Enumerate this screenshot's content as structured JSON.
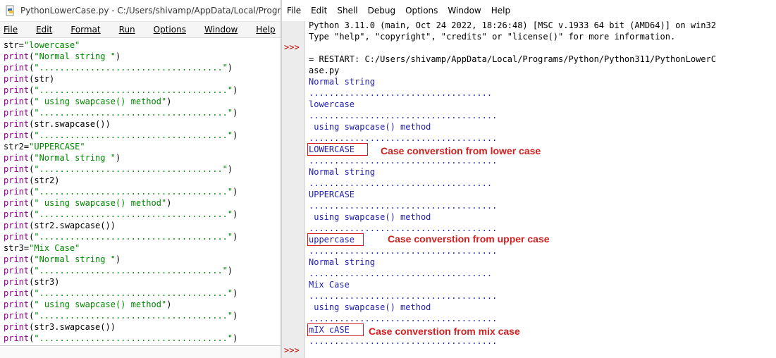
{
  "editor": {
    "title": "PythonLowerCase.py - C:/Users/shivamp/AppData/Local/Programs/Py",
    "menu": [
      "File",
      "Edit",
      "Format",
      "Run",
      "Options",
      "Window",
      "Help"
    ],
    "code": [
      {
        "a": "str=",
        "s": "\"lowercase\"",
        "b": ""
      },
      {
        "f": "print",
        "a": "(",
        "s": "\"Normal string \"",
        "b": ")"
      },
      {
        "f": "print",
        "a": "(",
        "s": "\"....................................\"",
        "b": ")"
      },
      {
        "f": "print",
        "a": "(str)",
        "s": "",
        "b": ""
      },
      {
        "f": "print",
        "a": "(",
        "s": "\".....................................\"",
        "b": ")"
      },
      {
        "f": "print",
        "a": "(",
        "s": "\" using swapcase() method\"",
        "b": ")"
      },
      {
        "f": "print",
        "a": "(",
        "s": "\".....................................\"",
        "b": ")"
      },
      {
        "f": "print",
        "a": "(str.swapcase())",
        "s": "",
        "b": ""
      },
      {
        "f": "print",
        "a": "(",
        "s": "\".....................................\"",
        "b": ")"
      },
      {
        "a": "str2=",
        "s": "\"UPPERCASE\"",
        "b": ""
      },
      {
        "f": "print",
        "a": "(",
        "s": "\"Normal string \"",
        "b": ")"
      },
      {
        "f": "print",
        "a": "(",
        "s": "\"....................................\"",
        "b": ")"
      },
      {
        "f": "print",
        "a": "(str2)",
        "s": "",
        "b": ""
      },
      {
        "f": "print",
        "a": "(",
        "s": "\".....................................\"",
        "b": ")"
      },
      {
        "f": "print",
        "a": "(",
        "s": "\" using swapcase() method\"",
        "b": ")"
      },
      {
        "f": "print",
        "a": "(",
        "s": "\".....................................\"",
        "b": ")"
      },
      {
        "f": "print",
        "a": "(str2.swapcase())",
        "s": "",
        "b": ""
      },
      {
        "f": "print",
        "a": "(",
        "s": "\".....................................\"",
        "b": ")"
      },
      {
        "a": "str3=",
        "s": "\"Mix Case\"",
        "b": ""
      },
      {
        "f": "print",
        "a": "(",
        "s": "\"Normal string \"",
        "b": ")"
      },
      {
        "f": "print",
        "a": "(",
        "s": "\"....................................\"",
        "b": ")"
      },
      {
        "f": "print",
        "a": "(str3)",
        "s": "",
        "b": ""
      },
      {
        "f": "print",
        "a": "(",
        "s": "\".....................................\"",
        "b": ")"
      },
      {
        "f": "print",
        "a": "(",
        "s": "\" using swapcase() method\"",
        "b": ")"
      },
      {
        "f": "print",
        "a": "(",
        "s": "\".....................................\"",
        "b": ")"
      },
      {
        "f": "print",
        "a": "(str3.swapcase())",
        "s": "",
        "b": ""
      },
      {
        "f": "print",
        "a": "(",
        "s": "\".....................................\"",
        "b": ")"
      }
    ]
  },
  "shell": {
    "menu": [
      "File",
      "Edit",
      "Shell",
      "Debug",
      "Options",
      "Window",
      "Help"
    ],
    "prompt": ">>>",
    "lines": [
      {
        "t": "Python 3.11.0 (main, Oct 24 2022, 18:26:48) [MSC v.1933 64 bit (AMD64)] on win32",
        "c": "sysline"
      },
      {
        "t": "Type \"help\", \"copyright\", \"credits\" or \"license()\" for more information.",
        "c": "sysline"
      },
      {
        "t": "",
        "c": "sysline"
      },
      {
        "t": "= RESTART: C:/Users/shivamp/AppData/Local/Programs/Python/Python311/PythonLowerC",
        "c": "sysline"
      },
      {
        "t": "ase.py",
        "c": "sysline"
      },
      {
        "t": "Normal string",
        "c": "blue"
      },
      {
        "t": "....................................",
        "c": "blue"
      },
      {
        "t": "lowercase",
        "c": "blue"
      },
      {
        "t": ".....................................",
        "c": "blue"
      },
      {
        "t": " using swapcase() method",
        "c": "blue"
      },
      {
        "t": ".....................................",
        "c": "blue"
      },
      {
        "t": "LOWERCASE",
        "c": "blue"
      },
      {
        "t": ".....................................",
        "c": "blue"
      },
      {
        "t": "Normal string",
        "c": "blue"
      },
      {
        "t": "....................................",
        "c": "blue"
      },
      {
        "t": "UPPERCASE",
        "c": "blue"
      },
      {
        "t": ".....................................",
        "c": "blue"
      },
      {
        "t": " using swapcase() method",
        "c": "blue"
      },
      {
        "t": ".....................................",
        "c": "blue"
      },
      {
        "t": "uppercase",
        "c": "blue"
      },
      {
        "t": ".....................................",
        "c": "blue"
      },
      {
        "t": "Normal string",
        "c": "blue"
      },
      {
        "t": "....................................",
        "c": "blue"
      },
      {
        "t": "Mix Case",
        "c": "blue"
      },
      {
        "t": ".....................................",
        "c": "blue"
      },
      {
        "t": " using swapcase() method",
        "c": "blue"
      },
      {
        "t": ".....................................",
        "c": "blue"
      },
      {
        "t": "mIX cASE",
        "c": "blue"
      },
      {
        "t": ".....................................",
        "c": "blue"
      }
    ]
  },
  "annotations": {
    "lower": "Case converstion from lower case",
    "upper": "Case converstion from upper case",
    "mix": "Case converstion from mix case"
  }
}
